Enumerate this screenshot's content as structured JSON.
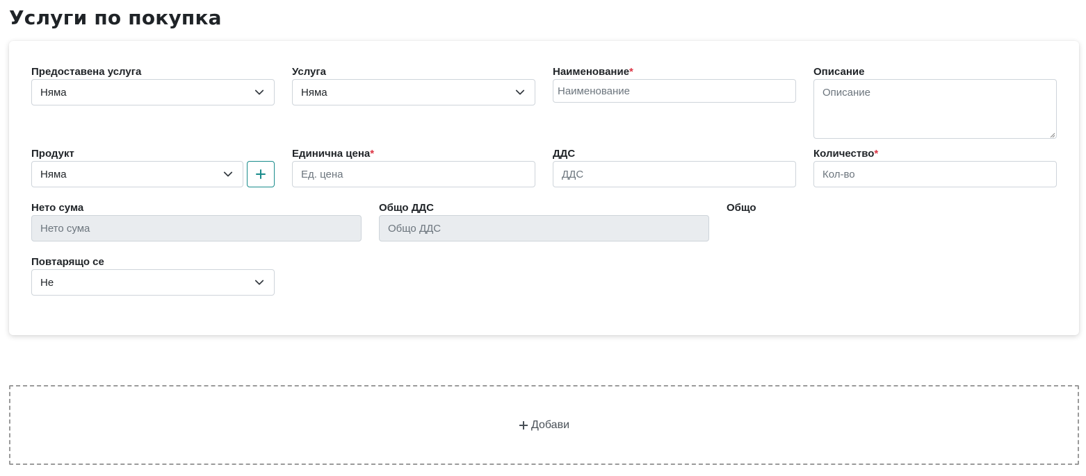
{
  "page": {
    "title": "Услуги по покупка"
  },
  "form": {
    "provided_service": {
      "label": "Предоставена услуга",
      "value": "Няма"
    },
    "service": {
      "label": "Услуга",
      "value": "Няма"
    },
    "name": {
      "label": "Наименование",
      "required_mark": "*",
      "placeholder": "Наименование",
      "value": ""
    },
    "description": {
      "label": "Описание",
      "placeholder": "Описание",
      "value": ""
    },
    "product": {
      "label": "Продукт",
      "value": "Няма",
      "add_button_icon": "plus-icon"
    },
    "unit_price": {
      "label": "Единична цена",
      "required_mark": "*",
      "placeholder": "Ед. цена",
      "value": ""
    },
    "vat": {
      "label": "ДДС",
      "placeholder": "ДДС",
      "value": ""
    },
    "quantity": {
      "label": "Количество",
      "required_mark": "*",
      "placeholder": "Кол-во",
      "value": ""
    },
    "net_sum": {
      "label": "Нето сума",
      "placeholder": "Нето сума",
      "value": ""
    },
    "total_vat": {
      "label": "Общо ДДС",
      "placeholder": "Общо ДДС",
      "value": ""
    },
    "total": {
      "label": "Общо"
    },
    "recurring": {
      "label": "Повтарящо се",
      "value": "Не"
    }
  },
  "dropzone": {
    "label": "Добави",
    "icon": "plus-icon"
  },
  "colors": {
    "accent": "#198b8b",
    "required": "#dc3545",
    "readonly_bg": "#e9ecef",
    "border": "#ced4da"
  }
}
